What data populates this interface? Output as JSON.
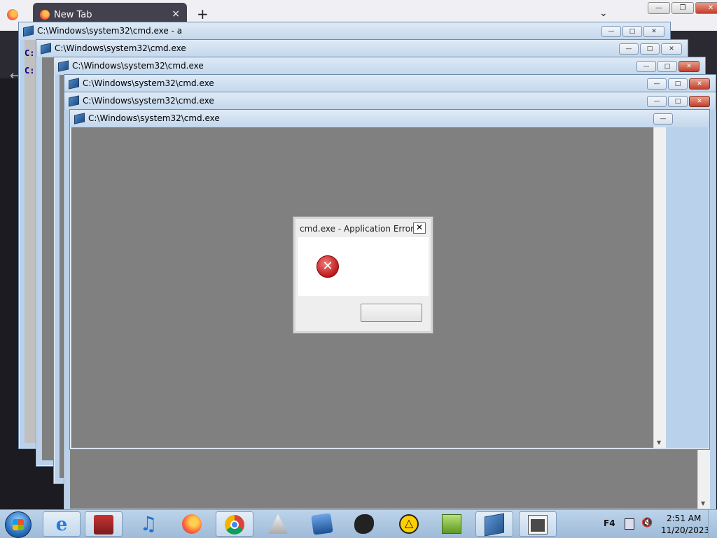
{
  "browser": {
    "tab_label": "New Tab",
    "tab_close": "×",
    "new_tab": "+",
    "tabs_list": "⌄",
    "back": "←",
    "menu": "☰",
    "caption_min": "—",
    "caption_restore": "❐",
    "caption_close": "✕"
  },
  "windows": [
    {
      "title": "C:\\Windows\\system32\\cmd.exe - a"
    },
    {
      "title": "C:\\Windows\\system32\\cmd.exe"
    },
    {
      "title": "C:\\Windows\\system32\\cmd.exe"
    },
    {
      "title": "C:\\Windows\\system32\\cmd.exe"
    },
    {
      "title": "C:\\Windows\\system32\\cmd.exe"
    },
    {
      "title": "C:\\Windows\\system32\\cmd.exe"
    }
  ],
  "window_buttons": {
    "minimize": "—",
    "maximize": "□",
    "close": "✕"
  },
  "console_prompt": "C:",
  "dialog": {
    "title": "cmd.exe - Application Error",
    "close": "✕",
    "icon": "error-icon",
    "button_label": ""
  },
  "taskbar": {
    "apps": [
      "internet-explorer",
      "store",
      "itunes",
      "firefox",
      "chrome",
      "java",
      "xcode",
      "paint",
      "warning-app",
      "notepad-plus",
      "cmd",
      "console"
    ],
    "language": "F4",
    "time": "2:51 AM",
    "date": "11/20/2023"
  },
  "colors": {
    "desktop_gray": "#808080",
    "title_blue": "#c3d7ec",
    "taskbar": "#bcd3ea",
    "error_red": "#c11a1a"
  }
}
